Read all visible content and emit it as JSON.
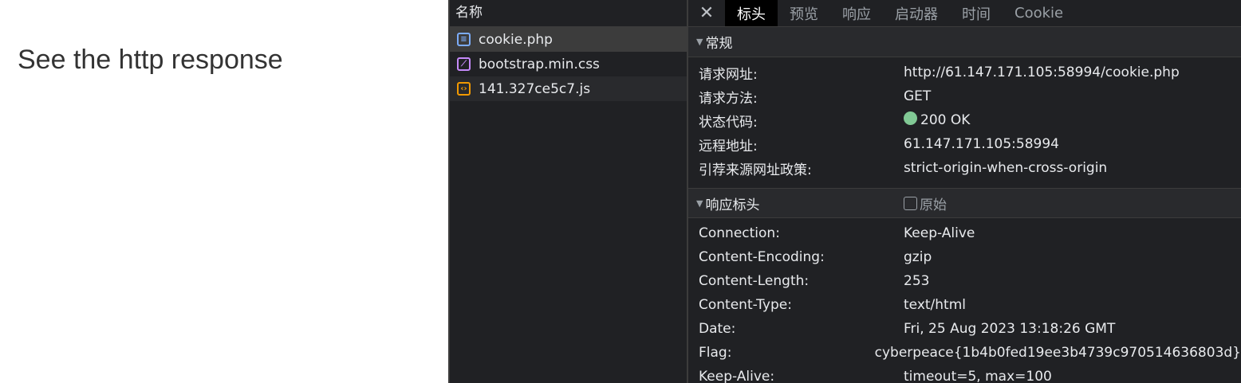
{
  "page": {
    "text": "See the http response"
  },
  "network": {
    "header": "名称",
    "requests": [
      {
        "name": "cookie.php",
        "icon": "document-icon"
      },
      {
        "name": "bootstrap.min.css",
        "icon": "stylesheet-icon"
      },
      {
        "name": "141.327ce5c7.js",
        "icon": "script-icon"
      }
    ]
  },
  "details": {
    "close": "✕",
    "tabs": [
      "标头",
      "预览",
      "响应",
      "启动器",
      "时间",
      "Cookie"
    ],
    "general": {
      "title": "常规",
      "rows": [
        {
          "key": "请求网址:",
          "value": "http://61.147.171.105:58994/cookie.php"
        },
        {
          "key": "请求方法:",
          "value": "GET"
        },
        {
          "key": "状态代码:",
          "value": "200 OK"
        },
        {
          "key": "远程地址:",
          "value": "61.147.171.105:58994"
        },
        {
          "key": "引荐来源网址政策:",
          "value": "strict-origin-when-cross-origin"
        }
      ]
    },
    "response_headers": {
      "title": "响应标头",
      "raw_label": "原始",
      "rows": [
        {
          "key": "Connection:",
          "value": "Keep-Alive"
        },
        {
          "key": "Content-Encoding:",
          "value": "gzip"
        },
        {
          "key": "Content-Length:",
          "value": "253"
        },
        {
          "key": "Content-Type:",
          "value": "text/html"
        },
        {
          "key": "Date:",
          "value": "Fri, 25 Aug 2023 13:18:26 GMT"
        },
        {
          "key": "Flag:",
          "value": "cyberpeace{1b4b0fed19ee3b4739c970514636803d}"
        },
        {
          "key": "Keep-Alive:",
          "value": "timeout=5, max=100"
        }
      ]
    }
  },
  "colors": {
    "status_ok": "#81c995",
    "panel_bg": "#202124"
  }
}
